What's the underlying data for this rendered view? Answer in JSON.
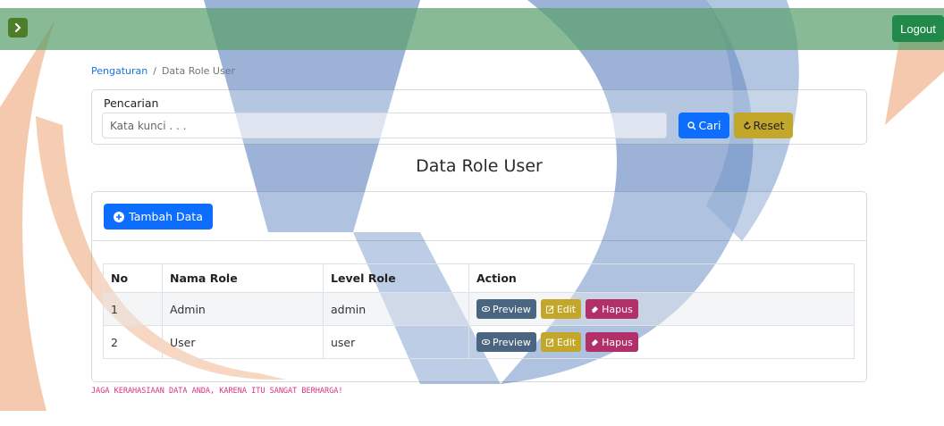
{
  "topbar": {
    "logout_label": "Logout"
  },
  "breadcrumb": {
    "parent": "Pengaturan",
    "separator": "/",
    "current": "Data Role User"
  },
  "search": {
    "label": "Pencarian",
    "placeholder": "Kata kunci . . .",
    "cari_label": "Cari",
    "reset_label": "Reset"
  },
  "page_title": "Data Role User",
  "toolbar": {
    "add_label": "Tambah Data"
  },
  "table": {
    "headers": [
      "No",
      "Nama Role",
      "Level Role",
      "Action"
    ],
    "rows": [
      {
        "no": "1",
        "nama": "Admin",
        "level": "admin"
      },
      {
        "no": "2",
        "nama": "User",
        "level": "user"
      }
    ],
    "actions": {
      "preview_label": "Preview",
      "edit_label": "Edit",
      "hapus_label": "Hapus"
    }
  },
  "footer_note": "JAGA KERAHASIAAN DATA ANDA, KARENA ITU SANGAT BERHARGA!",
  "colors": {
    "topbar": "#5ca06e",
    "primary": "#0d6efd",
    "warning": "#c2a72a",
    "danger": "#b1306a",
    "secondary": "#4a6580",
    "logout": "#218a4a",
    "watermark_blue": "#4f7fb8",
    "watermark_orange": "#f0b08a"
  }
}
